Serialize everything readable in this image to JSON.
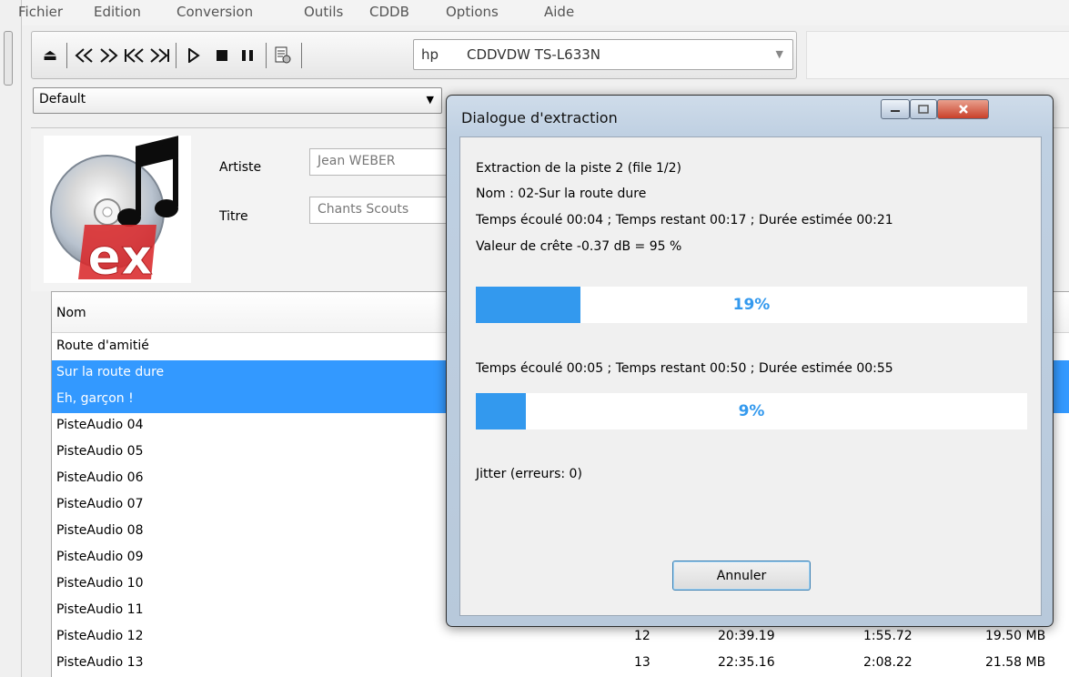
{
  "menu": [
    "Fichier",
    "Edition",
    "Conversion",
    "Outils",
    "CDDB",
    "Options",
    "Aide"
  ],
  "drive": {
    "vendor": "hp",
    "name": "CDDVDW TS-L633N"
  },
  "profile": "Default",
  "info": {
    "artist_label": "Artiste",
    "artist_value": "Jean WEBER",
    "title_label": "Titre",
    "title_value": "Chants Scouts"
  },
  "list": {
    "header_name": "Nom",
    "rows": [
      {
        "name": "Route d'amitié",
        "selected": false
      },
      {
        "name": "Sur la route dure",
        "selected": true
      },
      {
        "name": "Eh, garçon !",
        "selected": true
      },
      {
        "name": "PisteAudio 04",
        "selected": false
      },
      {
        "name": "PisteAudio 05",
        "selected": false
      },
      {
        "name": "PisteAudio 06",
        "selected": false
      },
      {
        "name": "PisteAudio 07",
        "selected": false
      },
      {
        "name": "PisteAudio 08",
        "selected": false
      },
      {
        "name": "PisteAudio 09",
        "selected": false
      },
      {
        "name": "PisteAudio 10",
        "selected": false
      },
      {
        "name": "PisteAudio 11",
        "selected": false
      },
      {
        "name": "PisteAudio 12",
        "selected": false,
        "num": "12",
        "start": "20:39.19",
        "duration": "1:55.72",
        "size": "19.50 MB"
      },
      {
        "name": "PisteAudio 13",
        "selected": false,
        "num": "13",
        "start": "22:35.16",
        "duration": "2:08.22",
        "size": "21.58 MB"
      }
    ]
  },
  "dialog": {
    "title": "Dialogue d'extraction",
    "line_track": "Extraction de la piste 2 (file 1/2)",
    "line_name": "Nom : 02-Sur la route dure",
    "line_time1": "Temps écoulé 00:04 ; Temps restant 00:17 ; Durée estimée 00:21",
    "line_peak": "Valeur de crête -0.37 dB =  95 %",
    "progress_track": {
      "value": 19,
      "label": "19%"
    },
    "line_time2": "Temps écoulé 00:05 ; Temps restant 00:50 ; Durée estimée 00:55",
    "progress_total": {
      "value": 9,
      "label": "9%"
    },
    "jitter": "Jitter (erreurs: 0)",
    "cancel_label": "Annuler"
  },
  "colors": {
    "selection": "#3399ff",
    "progress": "#3399ee"
  },
  "icons": [
    "eject-icon",
    "rewind-icon",
    "fast-forward-icon",
    "previous-track-icon",
    "next-track-icon",
    "play-icon",
    "stop-icon",
    "pause-icon",
    "cddb-query-icon",
    "cd-ex-logo"
  ]
}
